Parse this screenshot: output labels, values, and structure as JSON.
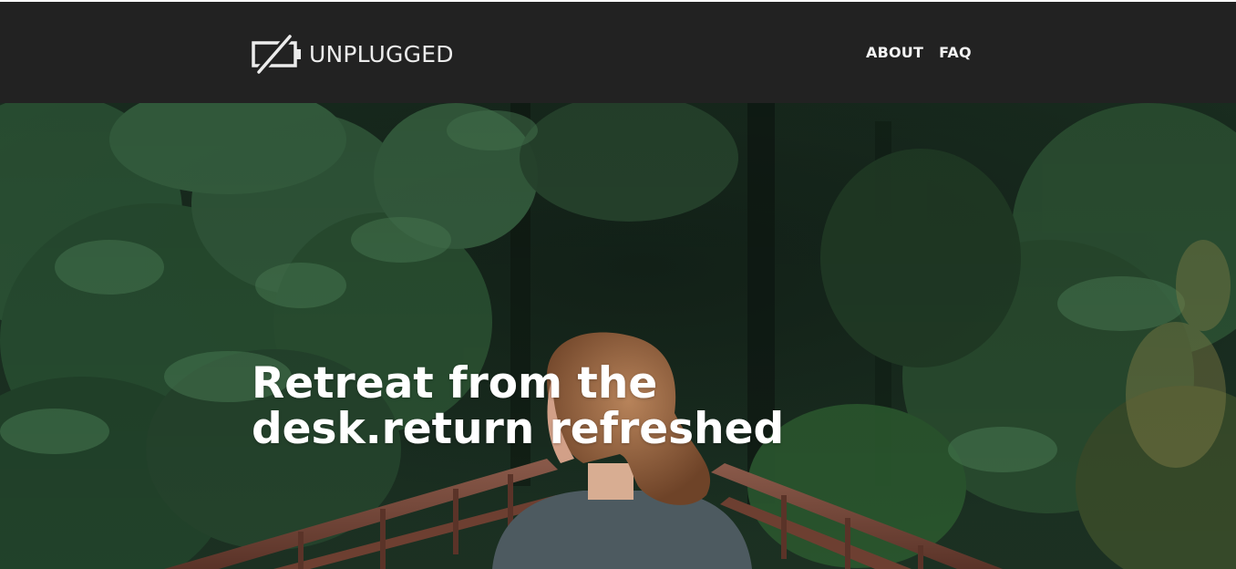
{
  "brand": {
    "name": "UNPLUGGED",
    "icon": "battery-slash-icon",
    "color": "#ececec"
  },
  "nav": {
    "items": [
      {
        "label": "ABOUT"
      },
      {
        "label": "FAQ"
      }
    ],
    "background": "#222222"
  },
  "hero": {
    "title_line_1": "Retreat from the",
    "title_line_2": "desk.return refreshed",
    "image": "forest-bridge-woman-photo"
  }
}
